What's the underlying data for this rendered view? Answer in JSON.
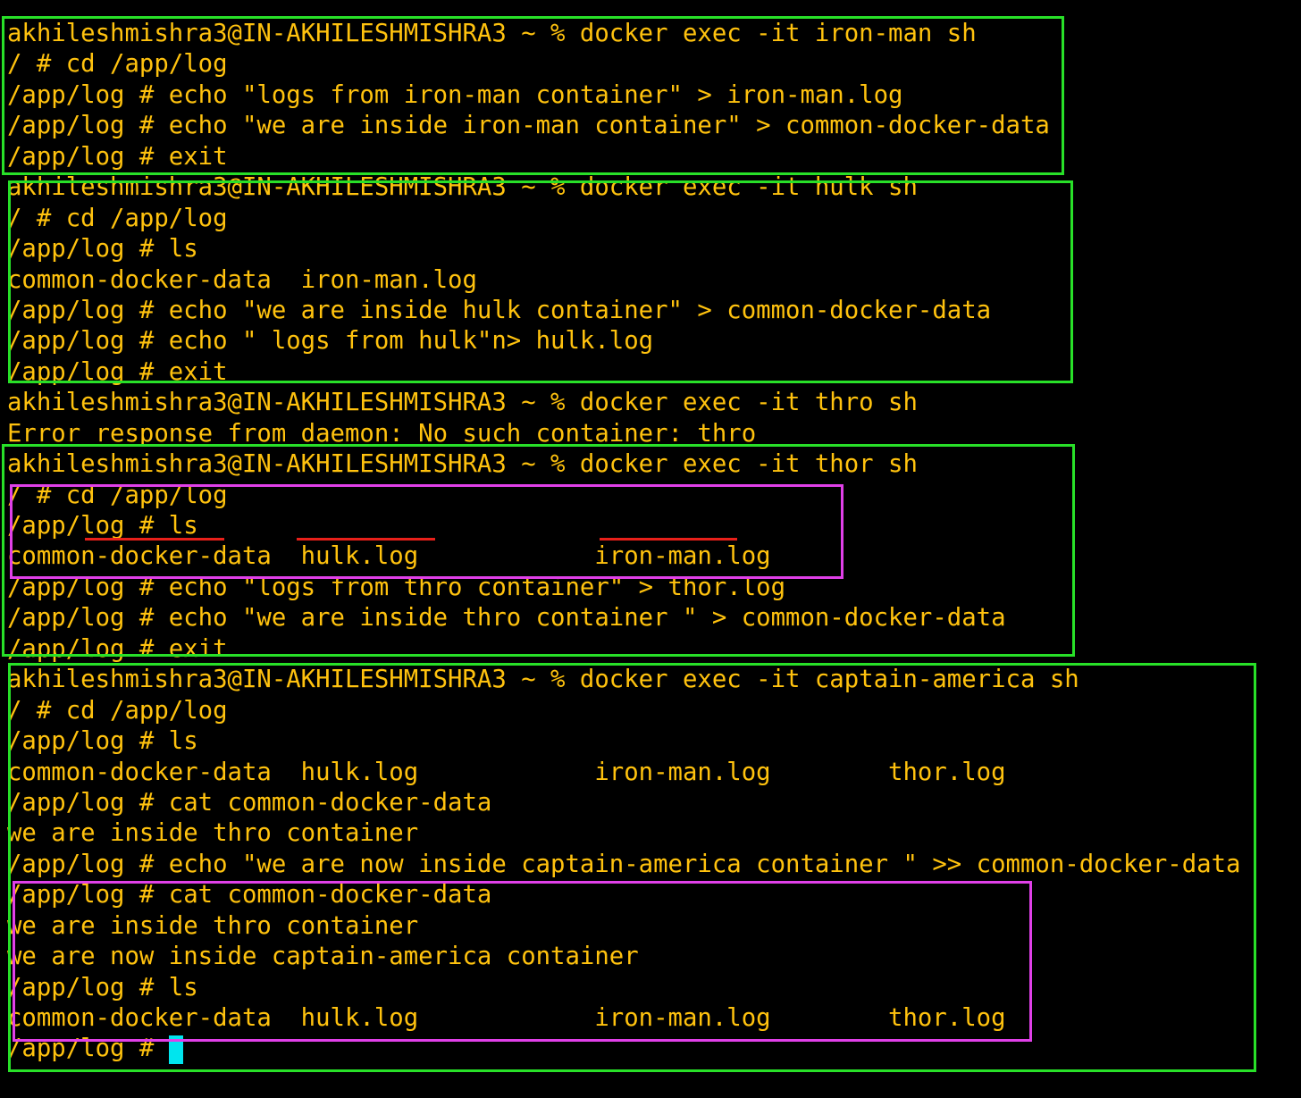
{
  "terminal": {
    "lines": [
      "akhileshmishra3@IN-AKHILESHMISHRA3 ~ % docker exec -it iron-man sh",
      "/ # cd /app/log",
      "/app/log # echo \"logs from iron-man container\" > iron-man.log",
      "/app/log # echo \"we are inside iron-man container\" > common-docker-data",
      "/app/log # exit",
      "akhileshmishra3@IN-AKHILESHMISHRA3 ~ % docker exec -it hulk sh",
      "/ # cd /app/log",
      "/app/log # ls",
      "common-docker-data  iron-man.log",
      "/app/log # echo \"we are inside hulk container\" > common-docker-data",
      "/app/log # echo \" logs from hulk\"n> hulk.log",
      "/app/log # exit",
      "akhileshmishra3@IN-AKHILESHMISHRA3 ~ % docker exec -it thro sh",
      "Error response from daemon: No such container: thro",
      "akhileshmishra3@IN-AKHILESHMISHRA3 ~ % docker exec -it thor sh",
      "/ # cd /app/log",
      "/app/log # ls",
      "common-docker-data  hulk.log            iron-man.log",
      "/app/log # echo \"logs from thro container\" > thor.log",
      "/app/log # echo \"we are inside thro container \" > common-docker-data",
      "/app/log # exit",
      "akhileshmishra3@IN-AKHILESHMISHRA3 ~ % docker exec -it captain-america sh",
      "/ # cd /app/log",
      "/app/log # ls",
      "common-docker-data  hulk.log            iron-man.log        thor.log",
      "/app/log # cat common-docker-data",
      "we are inside thro container",
      "/app/log # echo \"we are now inside captain-america container \" >> common-docker-data",
      "/app/log # cat common-docker-data",
      "we are inside thro container",
      "we are now inside captain-america container",
      "/app/log # ls",
      "common-docker-data  hulk.log            iron-man.log        thor.log"
    ],
    "prompt": "/app/log # "
  },
  "colors": {
    "background": "#000000",
    "text": "#ffc20e",
    "cursor": "#00e5ee",
    "annotation_green": "#28e028",
    "annotation_magenta": "#e040e8",
    "annotation_red": "#e8201a"
  }
}
